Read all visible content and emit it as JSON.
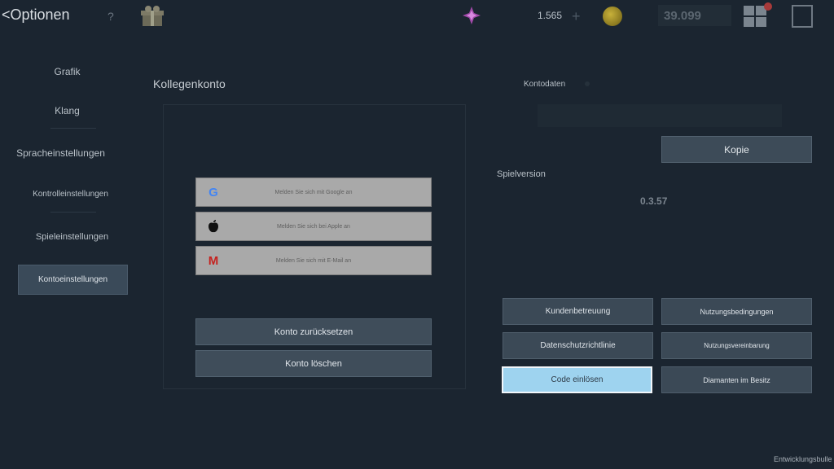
{
  "header": {
    "back_label": "<Optionen",
    "currency_1": "1.565",
    "plus_symbol": "+",
    "currency_2": "39.099"
  },
  "sidebar": {
    "items": [
      {
        "label": "Grafik"
      },
      {
        "label": "Klang"
      },
      {
        "label": "Spracheinstellungen"
      },
      {
        "label": "Kontrolleinstellungen"
      },
      {
        "label": "Spieleinstellungen"
      },
      {
        "label": "Kontoeinstellungen"
      }
    ],
    "active_index": 5
  },
  "account_panel": {
    "title": "Kollegenkonto",
    "login_buttons": [
      {
        "label": "Melden Sie sich mit Google an",
        "icon": "google-icon",
        "glyph": "G",
        "color": "#4285f4"
      },
      {
        "label": "Melden Sie sich bei Apple an",
        "icon": "apple-icon",
        "glyph": "",
        "color": "#111111"
      },
      {
        "label": "Melden Sie sich mit E-Mail an",
        "icon": "gmail-icon",
        "glyph": "M",
        "color": "#c5221f"
      }
    ],
    "reset_label": "Konto zurücksetzen",
    "delete_label": "Konto löschen"
  },
  "info_panel": {
    "kontodaten_label": "Kontodaten",
    "copy_label": "Kopie",
    "spielversion_label": "Spielversion",
    "version": "0.3.57",
    "buttons": [
      {
        "label": "Kundenbetreuung"
      },
      {
        "label": "Nutzungsbedingungen"
      },
      {
        "label": "Datenschutzrichtlinie"
      },
      {
        "label": "Nutzungsvereinbarung"
      },
      {
        "label": "Code einlösen"
      },
      {
        "label": "Diamanten im Besitz"
      }
    ]
  },
  "footer": {
    "label": "Entwicklungsbulle"
  },
  "colors": {
    "background": "#1b2530",
    "highlight": "#9ed3ef",
    "button": "#3b4956"
  }
}
